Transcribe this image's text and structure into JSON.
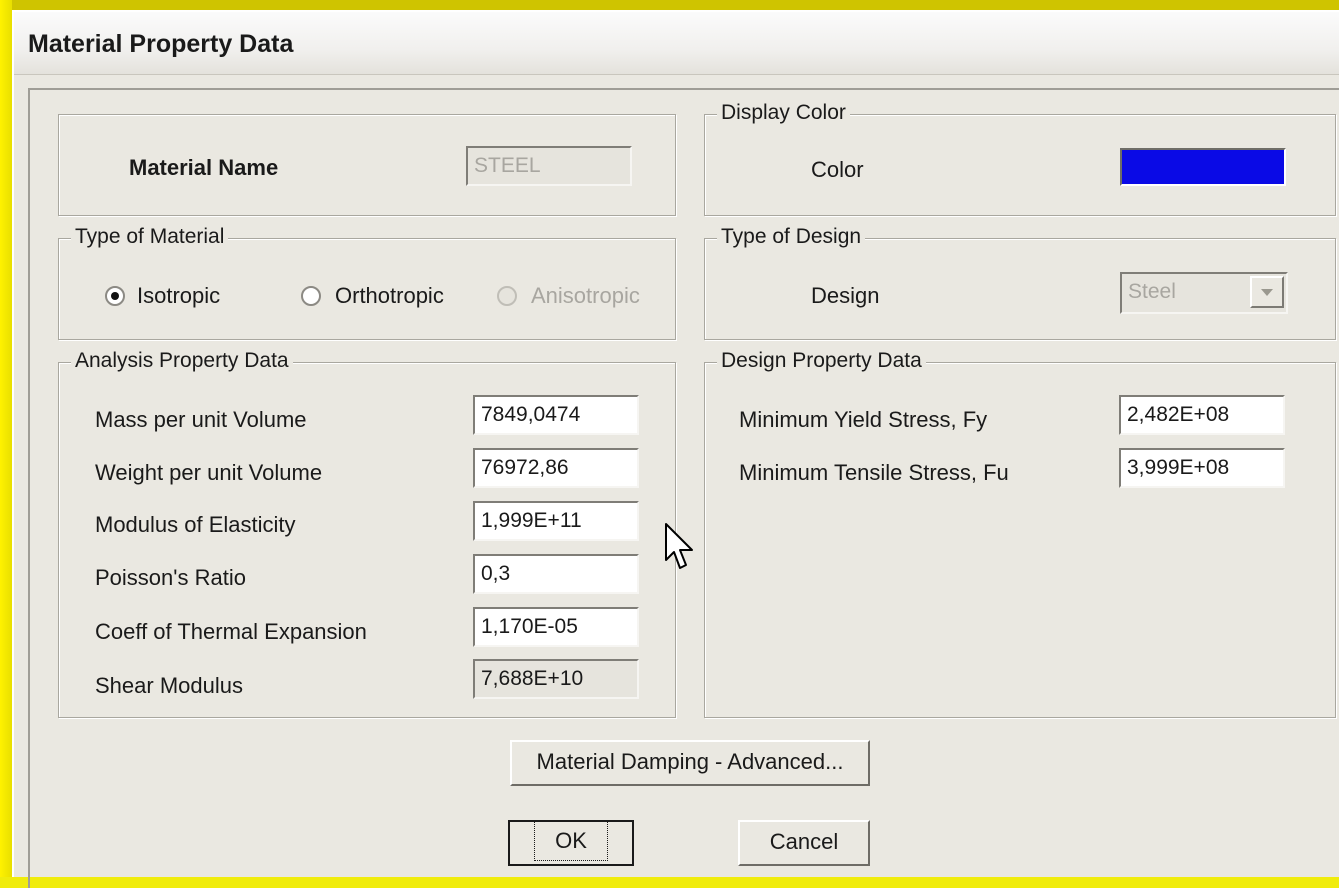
{
  "window": {
    "title": "Material Property Data"
  },
  "material": {
    "name_label": "Material Name",
    "name_value": "STEEL"
  },
  "display_color": {
    "legend": "Display Color",
    "color_label": "Color",
    "swatch": "#0a0ae6"
  },
  "type_of_material": {
    "legend": "Type of Material",
    "options": [
      {
        "label": "Isotropic",
        "selected": true,
        "enabled": true
      },
      {
        "label": "Orthotropic",
        "selected": false,
        "enabled": true
      },
      {
        "label": "Anisotropic",
        "selected": false,
        "enabled": false
      }
    ]
  },
  "type_of_design": {
    "legend": "Type of Design",
    "design_label": "Design",
    "design_value": "Steel"
  },
  "analysis": {
    "legend": "Analysis Property Data",
    "rows": [
      {
        "label": "Mass per unit Volume",
        "value": "7849,0474"
      },
      {
        "label": "Weight per unit Volume",
        "value": "76972,86"
      },
      {
        "label": "Modulus of Elasticity",
        "value": "1,999E+11"
      },
      {
        "label": "Poisson's Ratio",
        "value": "0,3"
      },
      {
        "label": "Coeff of Thermal Expansion",
        "value": "1,170E-05"
      },
      {
        "label": "Shear Modulus",
        "value": "7,688E+10"
      }
    ]
  },
  "design_props": {
    "legend": "Design Property Data",
    "rows": [
      {
        "label": "Minimum Yield Stress, Fy",
        "value": "2,482E+08"
      },
      {
        "label": "Minimum Tensile Stress, Fu",
        "value": "3,999E+08"
      }
    ]
  },
  "buttons": {
    "damping": "Material Damping - Advanced...",
    "ok": "OK",
    "cancel": "Cancel"
  }
}
